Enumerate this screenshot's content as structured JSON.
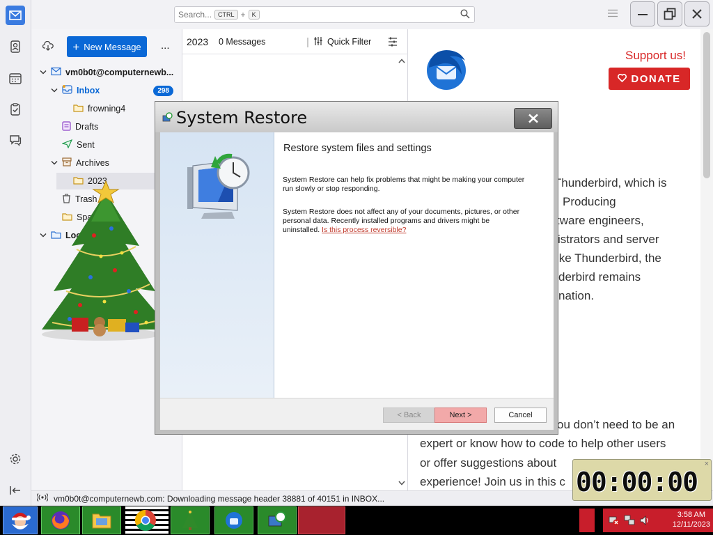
{
  "search": {
    "placeholder": "Search...",
    "key1": "CTRL",
    "plus": "+",
    "key2": "K"
  },
  "folders": {
    "new_message": "New Message",
    "more": "...",
    "account": "vm0b0t@computernewb...",
    "inbox": "Inbox",
    "inbox_count": "298",
    "frowning": "frowning4",
    "drafts": "Drafts",
    "sent": "Sent",
    "archives": "Archives",
    "year": "2023",
    "trash": "Trash",
    "spam": "Spa",
    "local": "Loca"
  },
  "list": {
    "folder": "2023",
    "count": "0 Messages",
    "quick_filter": "Quick Filter"
  },
  "reader": {
    "support": "Support us!",
    "donate": "DONATE",
    "lines": [
      "g Thunderbird, which is",
      "Producing",
      "tware engineers,",
      "istrators and server",
      "ike Thunderbird, the",
      "derbird remains",
      "nation."
    ],
    "lines2": [
      "ou don’t need to be an",
      "expert or know how to code to help other users",
      "or offer suggestions about",
      "experience! Join us in this c"
    ]
  },
  "status": {
    "text": "vm0b0t@computernewb.com: Downloading message header 38881 of 40151 in INBOX..."
  },
  "dialog": {
    "title": "System Restore",
    "heading": "Restore system files and settings",
    "p1": "System Restore can help fix problems that might be making your computer run slowly or stop responding.",
    "p2": "System Restore does not affect any of your documents, pictures, or other personal data. Recently installed programs and drivers might be uninstalled.",
    "link": "Is this process reversible?",
    "back": "< Back",
    "next": "Next >",
    "cancel": "Cancel"
  },
  "taskbar": {
    "time": "3:58 AM",
    "date": "12/11/2023"
  },
  "timer": {
    "value": "00:00:00"
  },
  "colors": {
    "accent": "#0a68d6",
    "donate": "#d82727",
    "taskbar_green": "#2a8a2a",
    "taskbar_red": "#a8222e"
  }
}
